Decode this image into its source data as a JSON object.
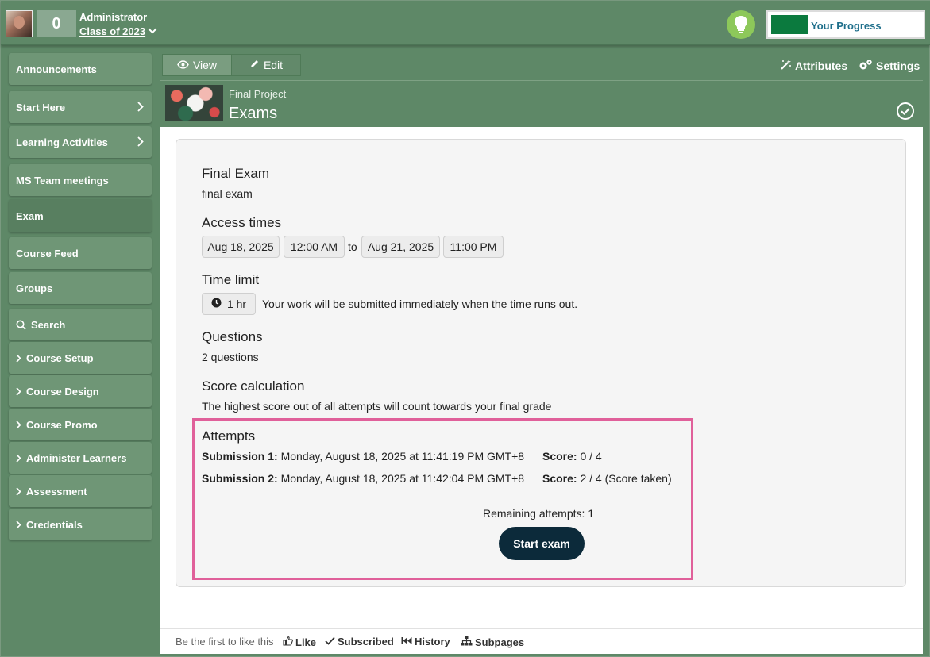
{
  "header": {
    "count": "0",
    "user_name": "Administrator",
    "class_name": "Class of 2023",
    "progress_label": "Your Progress",
    "progress_fraction": 0.25
  },
  "sidebar": {
    "items": [
      {
        "label": "Announcements"
      },
      {
        "label": "Start Here"
      },
      {
        "label": "Learning Activities"
      },
      {
        "label": "MS Team meetings"
      },
      {
        "label": "Exam"
      },
      {
        "label": "Course Feed"
      },
      {
        "label": "Groups"
      },
      {
        "label": "Search"
      },
      {
        "label": "Course Setup"
      },
      {
        "label": "Course Design"
      },
      {
        "label": "Course Promo"
      },
      {
        "label": "Administer Learners"
      },
      {
        "label": "Assessment"
      },
      {
        "label": "Credentials"
      }
    ]
  },
  "tabs": {
    "view": "View",
    "edit": "Edit",
    "attributes": "Attributes",
    "settings": "Settings"
  },
  "page": {
    "breadcrumb": "Final Project",
    "title": "Exams"
  },
  "exam": {
    "name_title": "Final Exam",
    "name_desc": "final exam",
    "access_title": "Access times",
    "start_date": "Aug 18, 2025",
    "start_time": "12:00 AM",
    "to_word": "to",
    "end_date": "Aug 21, 2025",
    "end_time": "11:00 PM",
    "time_limit_title": "Time limit",
    "time_limit_value": "1 hr",
    "time_limit_note": "Your work will be submitted immediately when the time runs out.",
    "questions_title": "Questions",
    "questions_value": "2 questions",
    "score_title": "Score calculation",
    "score_desc": "The highest score out of all attempts will count towards your final grade",
    "attempts_title": "Attempts",
    "submissions": [
      {
        "label": "Submission 1:",
        "date": "Monday, August 18, 2025 at 11:41:19 PM GMT+8",
        "score_label": "Score:",
        "score": "0 / 4"
      },
      {
        "label": "Submission 2:",
        "date": "Monday, August 18, 2025 at 11:42:04 PM GMT+8",
        "score_label": "Score:",
        "score": "2 / 4 (Score taken)"
      }
    ],
    "remaining": "Remaining attempts: 1",
    "start_button": "Start exam"
  },
  "footer": {
    "like_prompt": "Be the first to like this",
    "like": "Like",
    "subscribed": "Subscribed",
    "history": "History",
    "subpages": "Subpages"
  },
  "colors": {
    "theme_green": "#5e8867",
    "progress_green": "#0b7a3e",
    "highlight_pink": "#e0609a",
    "button_navy": "#0c2a3a"
  }
}
